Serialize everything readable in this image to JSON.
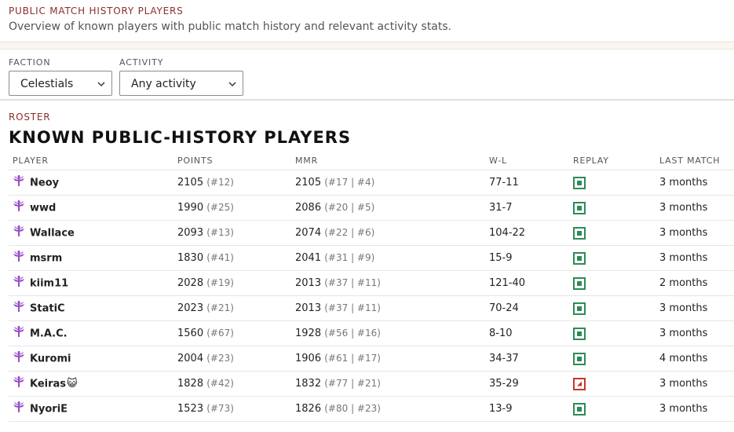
{
  "header": {
    "eyebrow": "PUBLIC MATCH HISTORY PLAYERS",
    "subtitle": "Overview of known players with public match history and relevant activity stats."
  },
  "filters": {
    "faction": {
      "label": "FACTION",
      "value": "Celestials"
    },
    "activity": {
      "label": "ACTIVITY",
      "value": "Any activity"
    }
  },
  "roster": {
    "label": "ROSTER",
    "title": "KNOWN PUBLIC-HISTORY PLAYERS",
    "columns": [
      "PLAYER",
      "POINTS",
      "MMR",
      "W-L",
      "REPLAY",
      "LAST MATCH"
    ],
    "rows": [
      {
        "name": "Neoy",
        "points": "2105",
        "points_rank": "(#12)",
        "mmr": "2105",
        "mmr_rank": "(#17",
        "mmr_faction_rank": "#4)",
        "wl": "77-11",
        "replay": "available",
        "last": "3 months"
      },
      {
        "name": "wwd",
        "points": "1990",
        "points_rank": "(#25)",
        "mmr": "2086",
        "mmr_rank": "(#20",
        "mmr_faction_rank": "#5)",
        "wl": "31-7",
        "replay": "available",
        "last": "3 months"
      },
      {
        "name": "Wallace",
        "points": "2093",
        "points_rank": "(#13)",
        "mmr": "2074",
        "mmr_rank": "(#22",
        "mmr_faction_rank": "#6)",
        "wl": "104-22",
        "replay": "available",
        "last": "3 months"
      },
      {
        "name": "msrm",
        "points": "1830",
        "points_rank": "(#41)",
        "mmr": "2041",
        "mmr_rank": "(#31",
        "mmr_faction_rank": "#9)",
        "wl": "15-9",
        "replay": "available",
        "last": "3 months"
      },
      {
        "name": "kiim11",
        "points": "2028",
        "points_rank": "(#19)",
        "mmr": "2013",
        "mmr_rank": "(#37",
        "mmr_faction_rank": "#11)",
        "wl": "121-40",
        "replay": "available",
        "last": "2 months"
      },
      {
        "name": "StatiC",
        "points": "2023",
        "points_rank": "(#21)",
        "mmr": "2013",
        "mmr_rank": "(#37",
        "mmr_faction_rank": "#11)",
        "wl": "70-24",
        "replay": "available",
        "last": "3 months"
      },
      {
        "name": "M.A.C.",
        "points": "1560",
        "points_rank": "(#67)",
        "mmr": "1928",
        "mmr_rank": "(#56",
        "mmr_faction_rank": "#16)",
        "wl": "8-10",
        "replay": "available",
        "last": "3 months"
      },
      {
        "name": "Kuromi",
        "points": "2004",
        "points_rank": "(#23)",
        "mmr": "1906",
        "mmr_rank": "(#61",
        "mmr_faction_rank": "#17)",
        "wl": "34-37",
        "replay": "available",
        "last": "4 months"
      },
      {
        "name": "Keiras",
        "emoji": "😺",
        "points": "1828",
        "points_rank": "(#42)",
        "mmr": "1832",
        "mmr_rank": "(#77",
        "mmr_faction_rank": "#21)",
        "wl": "35-29",
        "replay": "alternate",
        "last": "3 months"
      },
      {
        "name": "NyoriE",
        "points": "1523",
        "points_rank": "(#73)",
        "mmr": "1826",
        "mmr_rank": "(#80",
        "mmr_faction_rank": "#23)",
        "wl": "13-9",
        "replay": "available",
        "last": "3 months"
      }
    ]
  },
  "colors": {
    "accent": "#8b2e2e",
    "faction_icon": "#9b4dca",
    "replay_ok": "#2e8b57",
    "replay_alt": "#c0392b"
  },
  "icons": {
    "faction": "celestials-faction-icon",
    "replay": "replay-icon",
    "dropdown": "chevron-down-icon"
  }
}
